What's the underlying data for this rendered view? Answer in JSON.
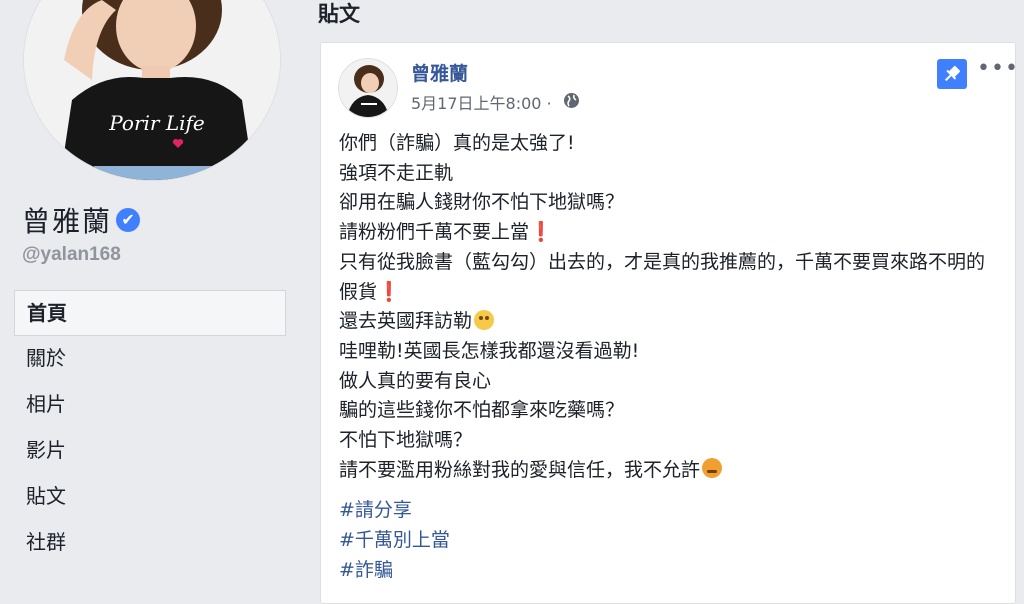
{
  "profile": {
    "name": "曾雅蘭",
    "handle": "@yalan168",
    "shirt_text": "Porir Life"
  },
  "nav": {
    "items": [
      {
        "label": "首頁",
        "active": true
      },
      {
        "label": "關於",
        "active": false
      },
      {
        "label": "相片",
        "active": false
      },
      {
        "label": "影片",
        "active": false
      },
      {
        "label": "貼文",
        "active": false
      },
      {
        "label": "社群",
        "active": false
      }
    ]
  },
  "section_title": "貼文",
  "post": {
    "author": "曾雅蘭",
    "timestamp": "5月17日上午8:00",
    "separator": "·",
    "lines": {
      "l1": "你們（詐騙）真的是太強了!",
      "l2": "強項不走正軌",
      "l3": "卻用在騙人錢財你不怕下地獄嗎？",
      "l4": "請粉粉們千萬不要上當",
      "l5": "只有從我臉書（藍勾勾）出去的，才是真的我推薦的，千萬不要買來路不明的假貨",
      "l6": "還去英國拜訪勒",
      "l7": "哇哩勒!英國長怎樣我都還沒看過勒!",
      "l8": "做人真的要有良心",
      "l9": "騙的這些錢你不怕都拿來吃藥嗎？",
      "l10": "不怕下地獄嗎？",
      "l11": "請不要濫用粉絲對我的愛與信任，我不允許"
    },
    "exclamation_emoji": "❗",
    "hashtags": [
      "#請分享",
      "#千萬別上當",
      "#詐騙"
    ]
  },
  "icons": {
    "verified": "verified-badge-icon",
    "globe": "globe-icon",
    "pin": "pin-icon",
    "more": "more-options-icon",
    "blush": "flushed-face-emoji",
    "angry": "angry-face-emoji"
  },
  "colors": {
    "page_bg": "#e9ebee",
    "link_blue": "#365899",
    "verified_blue": "#4080ff",
    "exclamation_red": "#e0245e"
  }
}
